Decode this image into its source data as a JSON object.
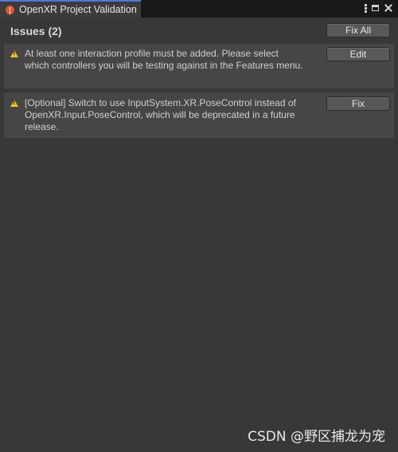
{
  "tab": {
    "title": "OpenXR Project Validation",
    "icon": "error-circle-icon",
    "icon_color": "#e2552b"
  },
  "window_controls": {
    "more_icon": "kebab-menu-icon",
    "maximize_icon": "maximize-icon",
    "close_icon": "close-icon"
  },
  "header": {
    "issues_label": "Issues (2)",
    "fix_all_label": "Fix All"
  },
  "issues": [
    {
      "icon": "warning-icon",
      "text": "At least one interaction profile must be added.  Please select which controllers you will be testing against in the Features menu.",
      "action_label": "Edit"
    },
    {
      "icon": "warning-icon",
      "text": "[Optional] Switch to use InputSystem.XR.PoseControl instead of OpenXR.Input.PoseControl, which will be deprecated in a future release.",
      "action_label": "Fix"
    }
  ],
  "colors": {
    "warning": "#f2c31a",
    "panel_bg": "#383838",
    "row_bg": "#464646",
    "tab_accent": "#4a7bd6"
  },
  "watermark": "CSDN @野区捕龙为宠"
}
